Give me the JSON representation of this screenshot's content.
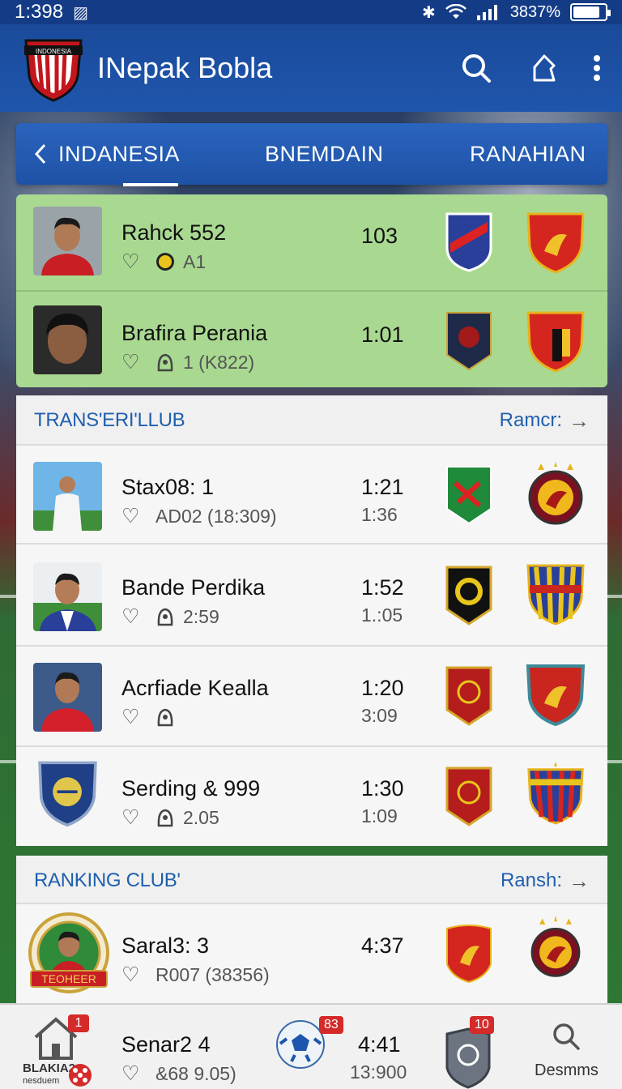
{
  "status_bar": {
    "time": "1:398",
    "battery_text": "3837%",
    "battery_level": 0.85
  },
  "app_bar": {
    "title": "INepak Bobla",
    "logo_text": "INDONESIA"
  },
  "tabs": [
    {
      "label": "INDANESIA"
    },
    {
      "label": "BNEMDAIN"
    },
    {
      "label": "RANAHIAN"
    }
  ],
  "featured_players": [
    {
      "name": "Rahck 552",
      "meta": "A1",
      "score": "103"
    },
    {
      "name": "Brafira Perania",
      "meta": "1 (K822)",
      "score": "1:01"
    }
  ],
  "transfer_section": {
    "title": "TRANS'ERI'LLUB",
    "more": "Ramcr:",
    "items": [
      {
        "name": "Stax08: 1",
        "meta": "AD02 (18:309)",
        "score": "1:21",
        "sub_score": "1:36"
      },
      {
        "name": "Bande Perdika",
        "meta": "2:59",
        "score": "1:52",
        "sub_score": "1.:05"
      },
      {
        "name": "Acrfiade Kealla",
        "meta": "",
        "score": "1:20",
        "sub_score": "3:09"
      },
      {
        "name": "Serding & 999",
        "meta": "2.05",
        "score": "1:30",
        "sub_score": "1:09"
      }
    ]
  },
  "ranking_section": {
    "title": "RANKING CLUB'",
    "more": "Ransh:",
    "items": [
      {
        "name": "Saral3: 3",
        "meta": "R007 (38356)",
        "score": "4:37",
        "badge_text": "TEOHEER"
      },
      {
        "name": "Senar2 4",
        "meta": "&68 9.05)",
        "score": "4:41",
        "sub_score": "13:900"
      }
    ]
  },
  "bottom_nav": {
    "home": {
      "label": "BLAKIA2",
      "sub_label": "nesduem",
      "badge": "1"
    },
    "ball": {
      "badge": "83"
    },
    "shield": {
      "badge": "10"
    },
    "search": {
      "label": "Desmms"
    }
  },
  "colors": {
    "primary": "#1f56ad",
    "featured_row": "#a9d991",
    "accent_text": "#1f5fae",
    "badge_red": "#d42a2a"
  }
}
